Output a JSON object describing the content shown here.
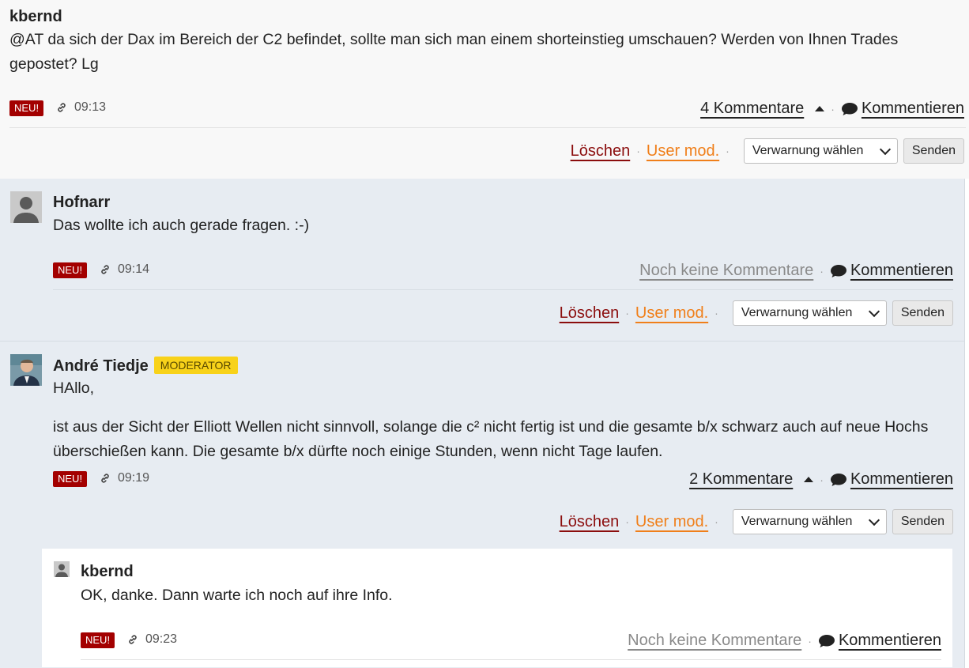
{
  "post": {
    "author": "kbernd",
    "text": "@AT da sich der Dax im Bereich der C2 befindet, sollte man sich man einem shorteinstieg umschauen? Werden von Ihnen Trades gepostet? Lg",
    "badge": "NEU!",
    "time": "09:13",
    "comments": "4 Kommentare",
    "comment_action": "Kommentieren",
    "delete": "Löschen",
    "user_mod": "User mod.",
    "warning_select": "Verwarnung wählen",
    "send": "Senden"
  },
  "reply1": {
    "author": "Hofnarr",
    "text": "Das wollte ich auch gerade fragen. :-)",
    "badge": "NEU!",
    "time": "09:14",
    "comments": "Noch keine Kommentare",
    "comment_action": "Kommentieren",
    "delete": "Löschen",
    "user_mod": "User mod.",
    "warning_select": "Verwarnung wählen",
    "send": "Senden"
  },
  "reply2": {
    "author": "André Tiedje",
    "role": "MODERATOR",
    "text_line1": "HAllo,",
    "text_para": "ist aus der Sicht der Elliott Wellen nicht sinnvoll, solange die c² nicht fertig ist und die gesamte b/x schwarz auch auf neue Hochs überschießen kann. Die gesamte b/x dürfte noch einige Stunden, wenn nicht Tage laufen.",
    "badge": "NEU!",
    "time": "09:19",
    "comments": "2 Kommentare",
    "comment_action": "Kommentieren",
    "delete": "Löschen",
    "user_mod": "User mod.",
    "warning_select": "Verwarnung wählen",
    "send": "Senden"
  },
  "nested": {
    "author": "kbernd",
    "text": "OK, danke. Dann warte ich noch auf ihre Info.",
    "badge": "NEU!",
    "time": "09:23",
    "comments": "Noch keine Kommentare",
    "comment_action": "Kommentieren"
  },
  "colors": {
    "badge_red": "#a30000",
    "delete_red": "#8b0d0d",
    "usermod_orange": "#f07f1a",
    "moderator_yellow": "#f8d21a",
    "reply_bg": "#e7ecf2"
  }
}
